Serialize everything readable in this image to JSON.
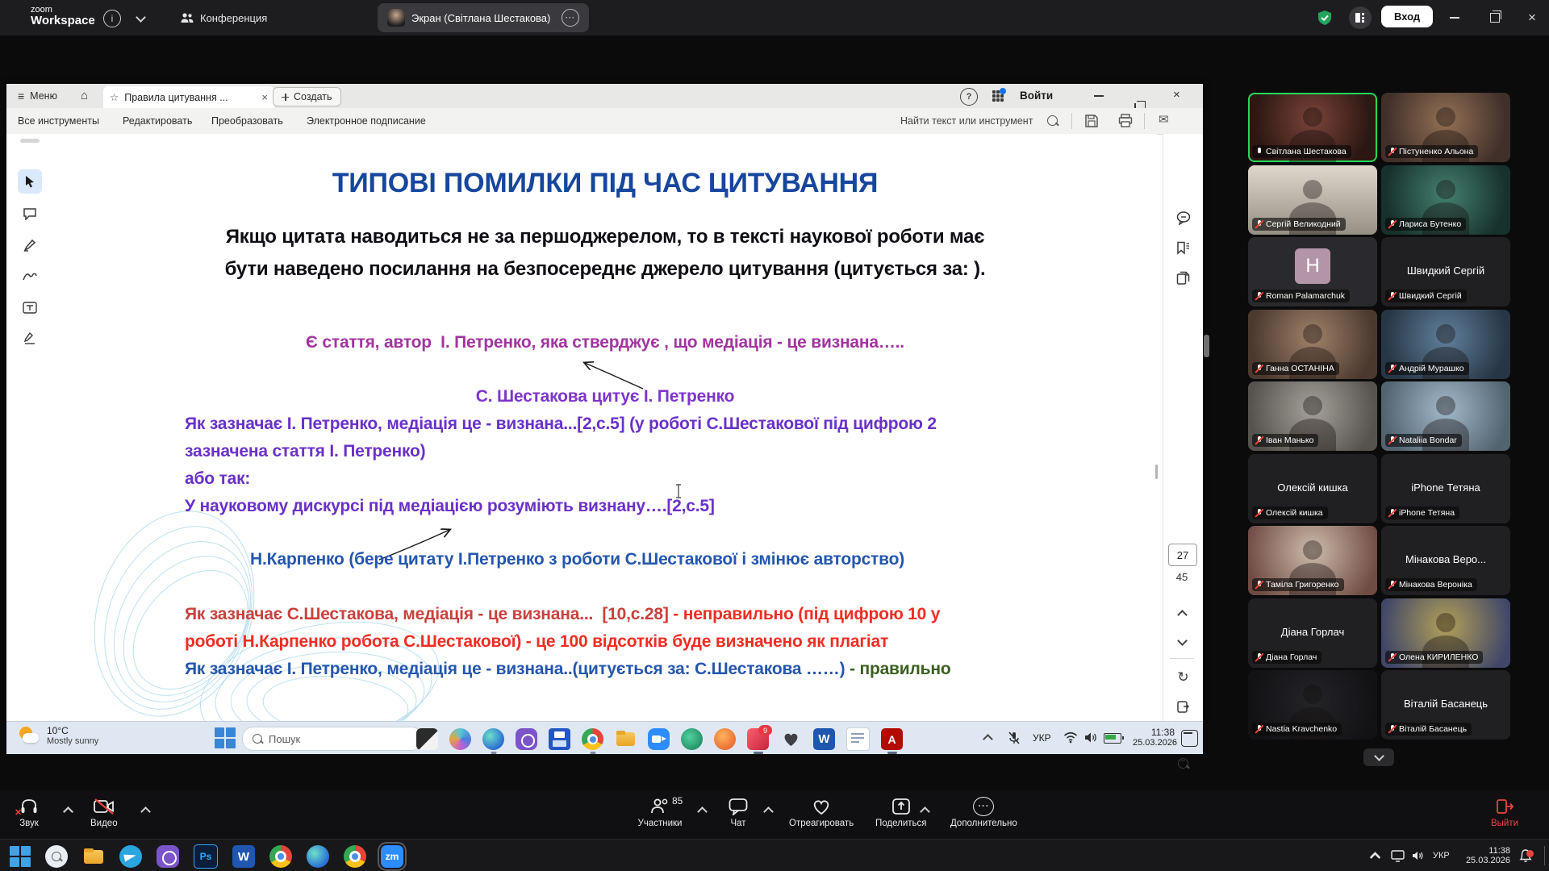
{
  "zoom_app": {
    "logo_line1": "zoom",
    "logo_line2": "Workspace",
    "meeting_tab": "Конференция",
    "screen_tab": "Экран (Світлана Шестакова)",
    "signin_button": "Вход"
  },
  "pdf_app": {
    "menu": "Меню",
    "doc_tab": "Правила цитування ...",
    "create_button": "Создать",
    "signin_button": "Войти",
    "toolbar": {
      "all_tools": "Все инструменты",
      "edit": "Редактировать",
      "convert": "Преобразовать",
      "esign": "Электронное подписание",
      "search_placeholder": "Найти текст или инструмент"
    },
    "page_current": "27",
    "page_total": "45"
  },
  "slide": {
    "title": "ТИПОВІ ПОМИЛКИ ПІД ЧАС ЦИТУВАННЯ",
    "para_line1": "Якщо цитата наводиться не за першоджерелом, то в тексті наукової роботи має",
    "para_line2": "бути наведено посилання на безпосереднє джерело цитування (цитується за: ).",
    "purple_line": "Є стаття, автор  І. Петренко, яка стверджує , що медіація - це визнана…..",
    "shestakova_line": "С. Шестакова цитує І. Петренко",
    "violet_line1": "Як зазначає І. Петренко, медіація це - визнана...[2,с.5] (у роботі С.Шестакової під цифрою 2",
    "violet_line2": "зазначена стаття І. Петренко)",
    "violet_line3": "або так:",
    "violet_line4": "У науковому дискурсі під медіацією розуміють визнану….[2,с.5]",
    "karpenko_line": "Н.Карпенко (бере цитату І.Петренко з роботи С.Шестакової і змінює авторство)",
    "red_line1_start": "Як зазначає С.Шестакова, медіація - це визнана...  [10,с.28]",
    "red_line1_end": " - неправильно (під цифрою 10 у",
    "red_line2": "роботі Н.Карпенко робота С.Шестакової) - це 100 відсотків буде визначено як плагіат",
    "final_line_blue": "Як зазначає І. Петренко, медіація це - визнана..(цитується за: С.Шестакова ……)",
    "final_line_green": " - правильно",
    "colors": {
      "title_blue": "#16469d",
      "purple": "#a234a0",
      "heading_violet": "#7e35c9",
      "violet": "#6a31c9",
      "blue": "#2456ae",
      "red": "#dd3128",
      "green": "#3a5f1f"
    }
  },
  "shared_taskbar": {
    "temperature": "10°C",
    "condition": "Mostly sunny",
    "search_placeholder": "Пошук",
    "notification_badge": "9",
    "lang": "УКР",
    "time": "11:38",
    "date": "25.03.2026"
  },
  "zoom_controls": {
    "audio": "Звук",
    "video": "Видео",
    "participants": "Участники",
    "participants_count": "85",
    "chat": "Чат",
    "react": "Отреагировать",
    "share": "Поделиться",
    "more": "Дополнительно",
    "leave": "Выйти"
  },
  "host_taskbar": {
    "lang": "УКР",
    "time": "11:38",
    "date": "25.03.2026",
    "photoshop_label": "Ps",
    "word_label": "W",
    "zoom_label": "zm",
    "acrobat_label": "A"
  },
  "participants": [
    {
      "name": "Світлана Шестакова"
    },
    {
      "name": "Пістуненко Альона"
    },
    {
      "name": "Сергій Великодний"
    },
    {
      "name": "Лариса Бутенко"
    },
    {
      "name": "Roman Palamarchuk",
      "initial": "H"
    },
    {
      "name": "Швидкий Сергій",
      "center": "Швидкий Сергій"
    },
    {
      "name": "Ганна ОСТАНІНА"
    },
    {
      "name": "Андрій Мурашко"
    },
    {
      "name": "Іван Манько"
    },
    {
      "name": "Nataliia Bondar"
    },
    {
      "name": "Олексій кишка",
      "center": "Олексій кишка"
    },
    {
      "name": "iPhone Тетяна",
      "center": "iPhone Тетяна"
    },
    {
      "name": "Таміла Григоренко"
    },
    {
      "name": "Мінакова Вероніка",
      "center": "Мінакова  Веро..."
    },
    {
      "name": "Діана Горлач",
      "center": "Діана Горлач"
    },
    {
      "name": "Олена КИРИЛЕНКО"
    },
    {
      "name": "Nastia Kravchenko"
    },
    {
      "name": "Віталій Басанець",
      "center": "Віталій Басанець"
    }
  ]
}
